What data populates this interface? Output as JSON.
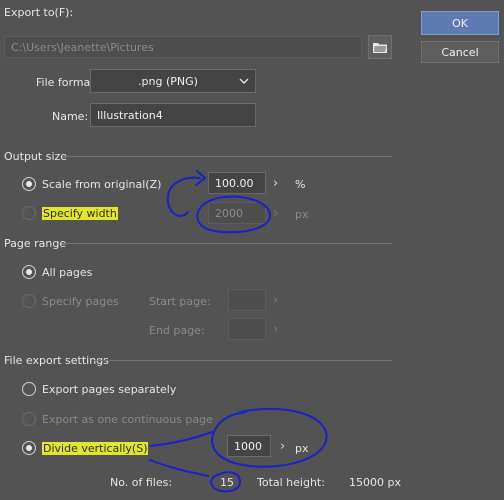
{
  "export_to": {
    "label": "Export to(F):",
    "path": "C:\\Users\\Jeanette\\Pictures"
  },
  "buttons": {
    "ok": "OK",
    "cancel": "Cancel"
  },
  "file_format": {
    "label": "File format:",
    "value": ".png (PNG)"
  },
  "name": {
    "label": "Name:",
    "value": "Illustration4"
  },
  "output_size": {
    "heading": "Output size",
    "scale_label": "Scale from original(Z)",
    "scale_value": "100.00",
    "scale_unit": "%",
    "width_label": "Specify width",
    "width_value": "2000",
    "width_unit": "px"
  },
  "page_range": {
    "heading": "Page range",
    "all_pages": "All pages",
    "specify_pages": "Specify pages",
    "start_page": "Start page:",
    "end_page": "End page:"
  },
  "file_export": {
    "heading": "File export settings",
    "separately": "Export pages separately",
    "continuous": "Export as one continuous page",
    "divide": "Divide vertically(S)",
    "divide_value": "1000",
    "divide_unit": "px",
    "files_label": "No. of files:",
    "files_value": "15",
    "total_label": "Total height:",
    "total_value": "15000 px"
  },
  "colors": {
    "background": "#535353",
    "highlight": "#e1e62a",
    "annotation": "#1a22c8",
    "ok_button": "#5d7ab1"
  }
}
